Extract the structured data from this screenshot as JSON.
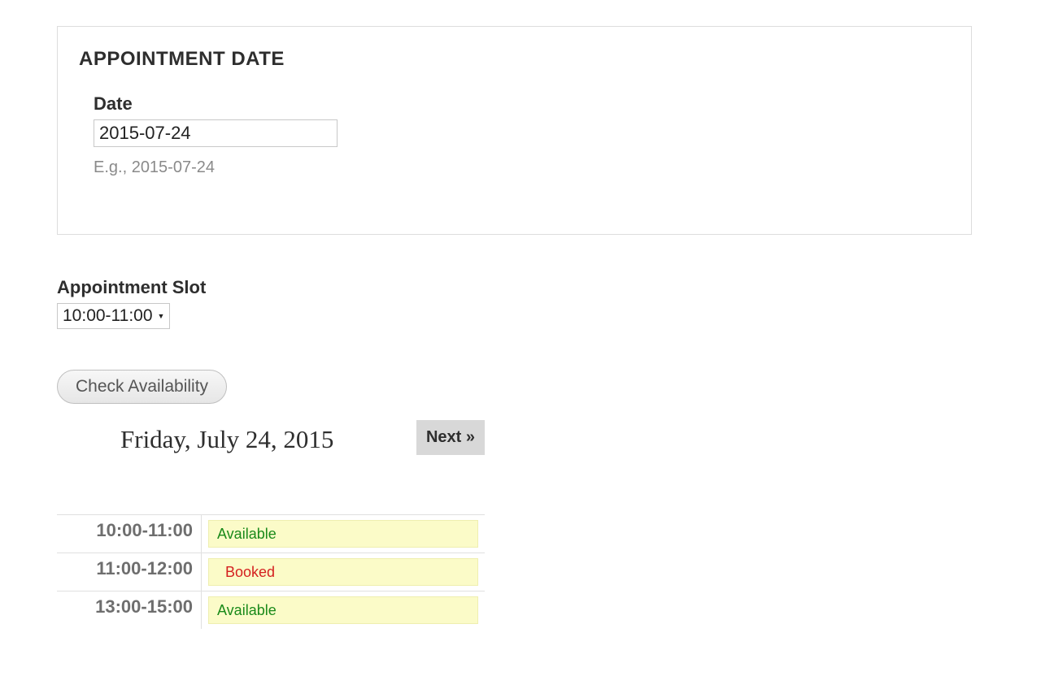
{
  "fieldset": {
    "legend": "APPOINTMENT DATE",
    "date_label": "Date",
    "date_value": "2015-07-24",
    "date_hint": "E.g., 2015-07-24"
  },
  "slot": {
    "label": "Appointment Slot",
    "selected": "10:00-11:00"
  },
  "actions": {
    "check_label": "Check Availability",
    "next_label": "Next »"
  },
  "dayview": {
    "title": "Friday, July 24, 2015",
    "rows": [
      {
        "time": "10:00-11:00",
        "status": "Available",
        "status_key": "available"
      },
      {
        "time": "11:00-12:00",
        "status": "Booked",
        "status_key": "booked"
      },
      {
        "time": "13:00-15:00",
        "status": "Available",
        "status_key": "available"
      }
    ]
  }
}
